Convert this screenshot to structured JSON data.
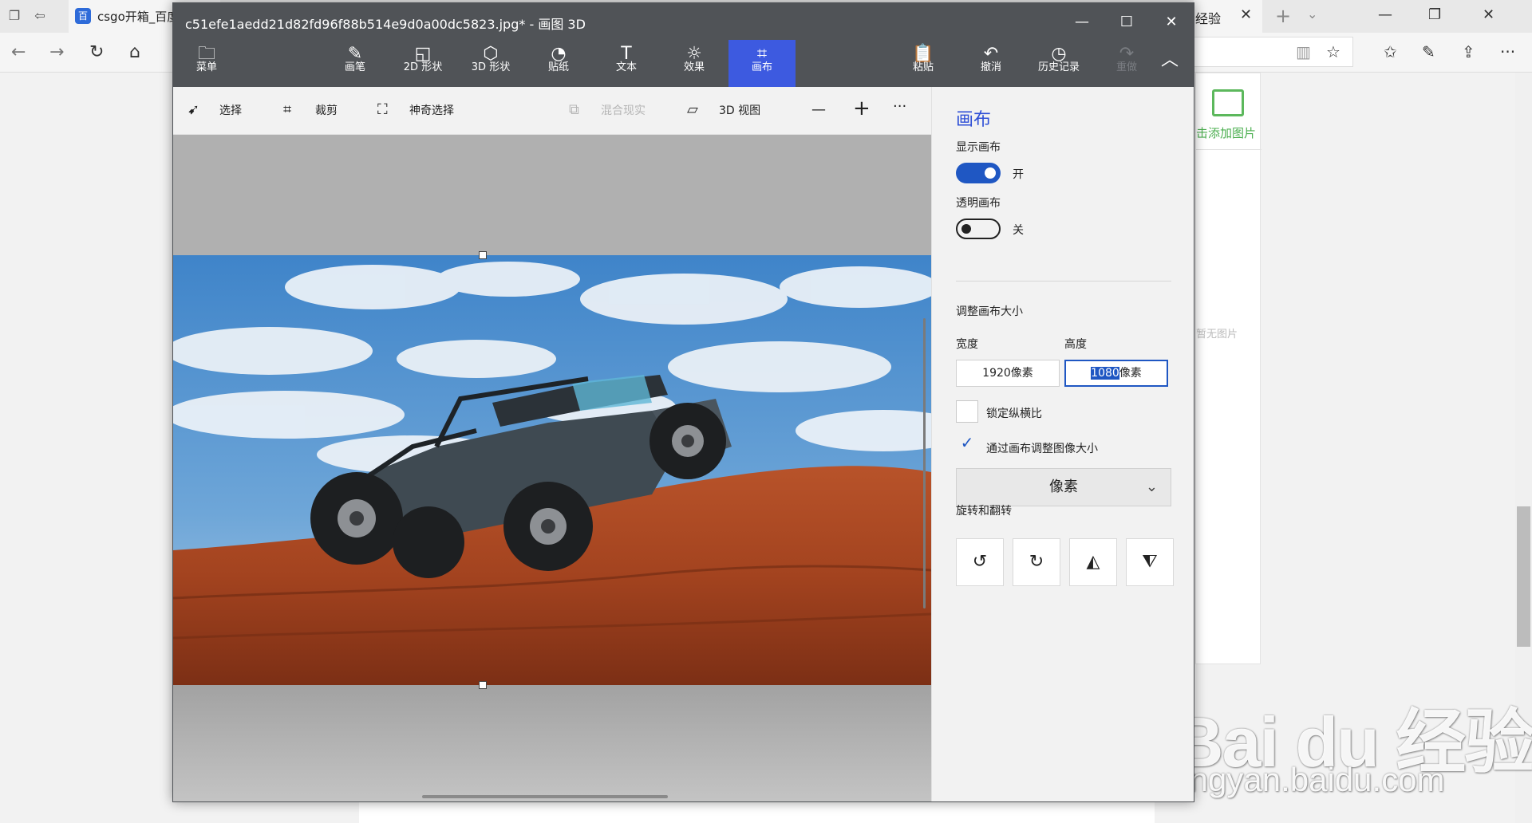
{
  "browser": {
    "tab_active_title": "csgo开箱_百度",
    "tab_second_title": "经验",
    "web_add_image": "击添加图片",
    "web_no_image": "暂无图片"
  },
  "watermark": {
    "brand": "Bai du 经验",
    "url": "jingyan.baidu.com"
  },
  "app": {
    "title": "c51efe1aedd21d82fd96f88b514e9d0a00dc5823.jpg* - 画图 3D",
    "ribbon": {
      "menu": "菜单",
      "brushes": "画笔",
      "shapes_2d": "2D 形状",
      "shapes_3d": "3D 形状",
      "stickers": "贴纸",
      "text": "文本",
      "effects": "效果",
      "canvas": "画布",
      "paste": "粘贴",
      "undo": "撤消",
      "history": "历史记录",
      "redo": "重做"
    },
    "toolbar": {
      "select": "选择",
      "crop": "裁剪",
      "magic_select": "神奇选择",
      "mixed_reality": "混合现实",
      "view_3d": "3D 视图",
      "zoom_out": "—",
      "zoom_in": "+",
      "more": "···"
    },
    "panel": {
      "title": "画布",
      "show_canvas_label": "显示画布",
      "show_canvas_state": "开",
      "transparent_canvas_label": "透明画布",
      "transparent_canvas_state": "关",
      "resize_label": "调整画布大小",
      "width_label": "宽度",
      "height_label": "高度",
      "width_value": "1920像素",
      "height_value_selected": "1080",
      "height_value_unit": "像素",
      "lock_aspect_label": "锁定纵横比",
      "resize_image_label": "通过画布调整图像大小",
      "unit_select": "像素",
      "rotate_flip_label": "旋转和翻转"
    }
  }
}
